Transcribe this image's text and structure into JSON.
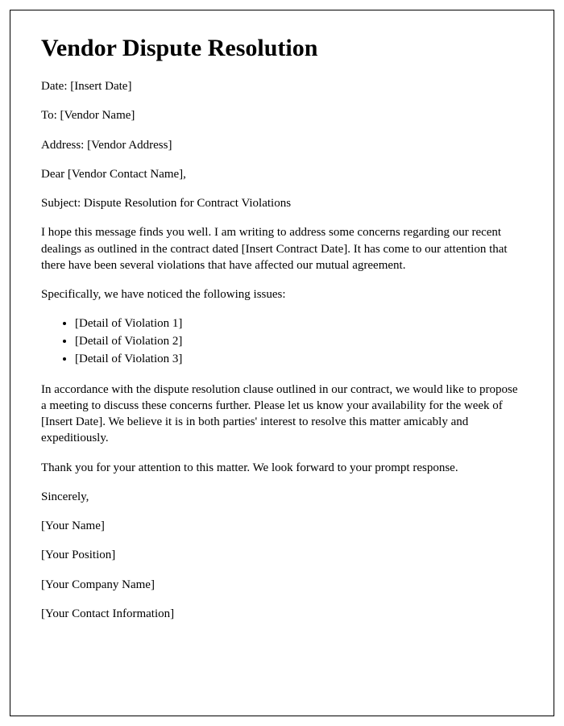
{
  "title": "Vendor Dispute Resolution",
  "date_line": "Date: [Insert Date]",
  "to_line": "To: [Vendor Name]",
  "address_line": "Address: [Vendor Address]",
  "salutation": "Dear [Vendor Contact Name],",
  "subject_line": "Subject: Dispute Resolution for Contract Violations",
  "intro_paragraph": "I hope this message finds you well. I am writing to address some concerns regarding our recent dealings as outlined in the contract dated [Insert Contract Date]. It has come to our attention that there have been several violations that have affected our mutual agreement.",
  "issues_intro": "Specifically, we have noticed the following issues:",
  "violations": [
    "[Detail of Violation 1]",
    "[Detail of Violation 2]",
    "[Detail of Violation 3]"
  ],
  "resolution_paragraph": "In accordance with the dispute resolution clause outlined in our contract, we would like to propose a meeting to discuss these concerns further. Please let us know your availability for the week of [Insert Date]. We believe it is in both parties' interest to resolve this matter amicably and expeditiously.",
  "closing_paragraph": "Thank you for your attention to this matter. We look forward to your prompt response.",
  "signoff": "Sincerely,",
  "sender_name": "[Your Name]",
  "sender_position": "[Your Position]",
  "sender_company": "[Your Company Name]",
  "sender_contact": "[Your Contact Information]"
}
